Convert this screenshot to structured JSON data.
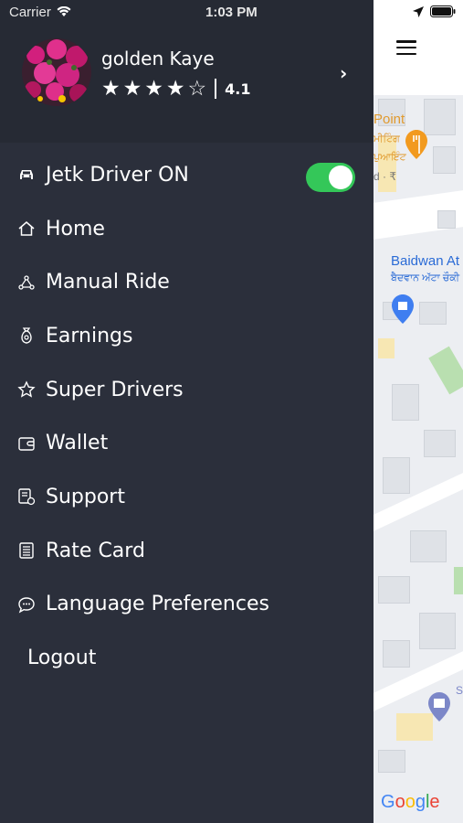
{
  "status_bar": {
    "carrier": "Carrier",
    "time": "1:03 PM"
  },
  "profile": {
    "name": "golden Kaye",
    "rating": "4.1",
    "stars_filled": 4,
    "stars_total": 5
  },
  "menu": {
    "driver_toggle_label": "Jetk Driver ON",
    "driver_toggle_on": true,
    "items": [
      {
        "label": "Home",
        "icon": "home-icon"
      },
      {
        "label": "Manual Ride",
        "icon": "network-icon"
      },
      {
        "label": "Earnings",
        "icon": "money-bag-icon"
      },
      {
        "label": "Super Drivers",
        "icon": "star-icon"
      },
      {
        "label": "Wallet",
        "icon": "wallet-icon"
      },
      {
        "label": "Support",
        "icon": "support-icon"
      },
      {
        "label": "Rate Card",
        "icon": "rate-card-icon"
      },
      {
        "label": "Language Preferences",
        "icon": "chat-icon"
      }
    ],
    "logout_label": "Logout"
  },
  "map": {
    "label_point": "Point",
    "label_punjabi_1": "ਪੁਆਇੰਟ",
    "label_punjabi_2": "ਮੀਟਿੰਗ",
    "label_cost": "d · ₹",
    "label_place": "Baidwan At",
    "label_place_punjabi": "ਬੈਦਵਾਨ ਅੱਟਾ ਚੌਕੀ",
    "label_s": "S",
    "google": "Google"
  },
  "colors": {
    "drawer_bg": "#2b2f3b",
    "header_bg": "#262a34",
    "toggle_on": "#34c759"
  }
}
